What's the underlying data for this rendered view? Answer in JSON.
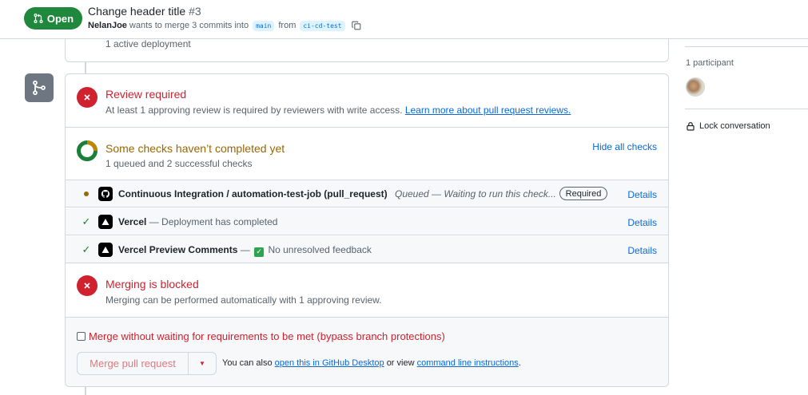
{
  "header": {
    "state": "Open",
    "title": "Change header title",
    "number": "#3",
    "author": "NelanJoe",
    "merge_text": "wants to merge 3 commits into",
    "base_branch": "main",
    "from_text": "from",
    "head_branch": "ci-cd-test"
  },
  "deployment": {
    "summary": "1 active deployment"
  },
  "review": {
    "title": "Review required",
    "description": "At least 1 approving review is required by reviewers with write access.",
    "link": "Learn more about pull request reviews."
  },
  "checks": {
    "title": "Some checks haven’t completed yet",
    "summary": "1 queued and 2 successful checks",
    "toggle": "Hide all checks",
    "rows": [
      {
        "status": "queued",
        "name": "Continuous Integration / automation-test-job (pull_request)",
        "description": "Queued — Waiting to run this check...",
        "badge": "Required",
        "details": "Details"
      },
      {
        "status": "success",
        "name": "Vercel",
        "description": "— Deployment has completed",
        "details": "Details"
      },
      {
        "status": "success",
        "name": "Vercel Preview Comments",
        "prefix": "—",
        "description": "No unresolved feedback",
        "details": "Details"
      }
    ]
  },
  "blocked": {
    "title": "Merging is blocked",
    "description": "Merging can be performed automatically with 1 approving review."
  },
  "merge": {
    "bypass_label": "Merge without waiting for requirements to be met (bypass branch protections)",
    "button": "Merge pull request",
    "alt_prefix": "You can also",
    "alt_link1": "open this in GitHub Desktop",
    "alt_middle": "or view",
    "alt_link2": "command line instructions",
    "alt_suffix": "."
  },
  "sidebar": {
    "participants": "1 participant",
    "lock": "Lock conversation"
  },
  "colors": {
    "open_green": "#1f883d",
    "danger_red": "#cf222e",
    "attention_amber": "#9a6700",
    "link_blue": "#0969da"
  }
}
